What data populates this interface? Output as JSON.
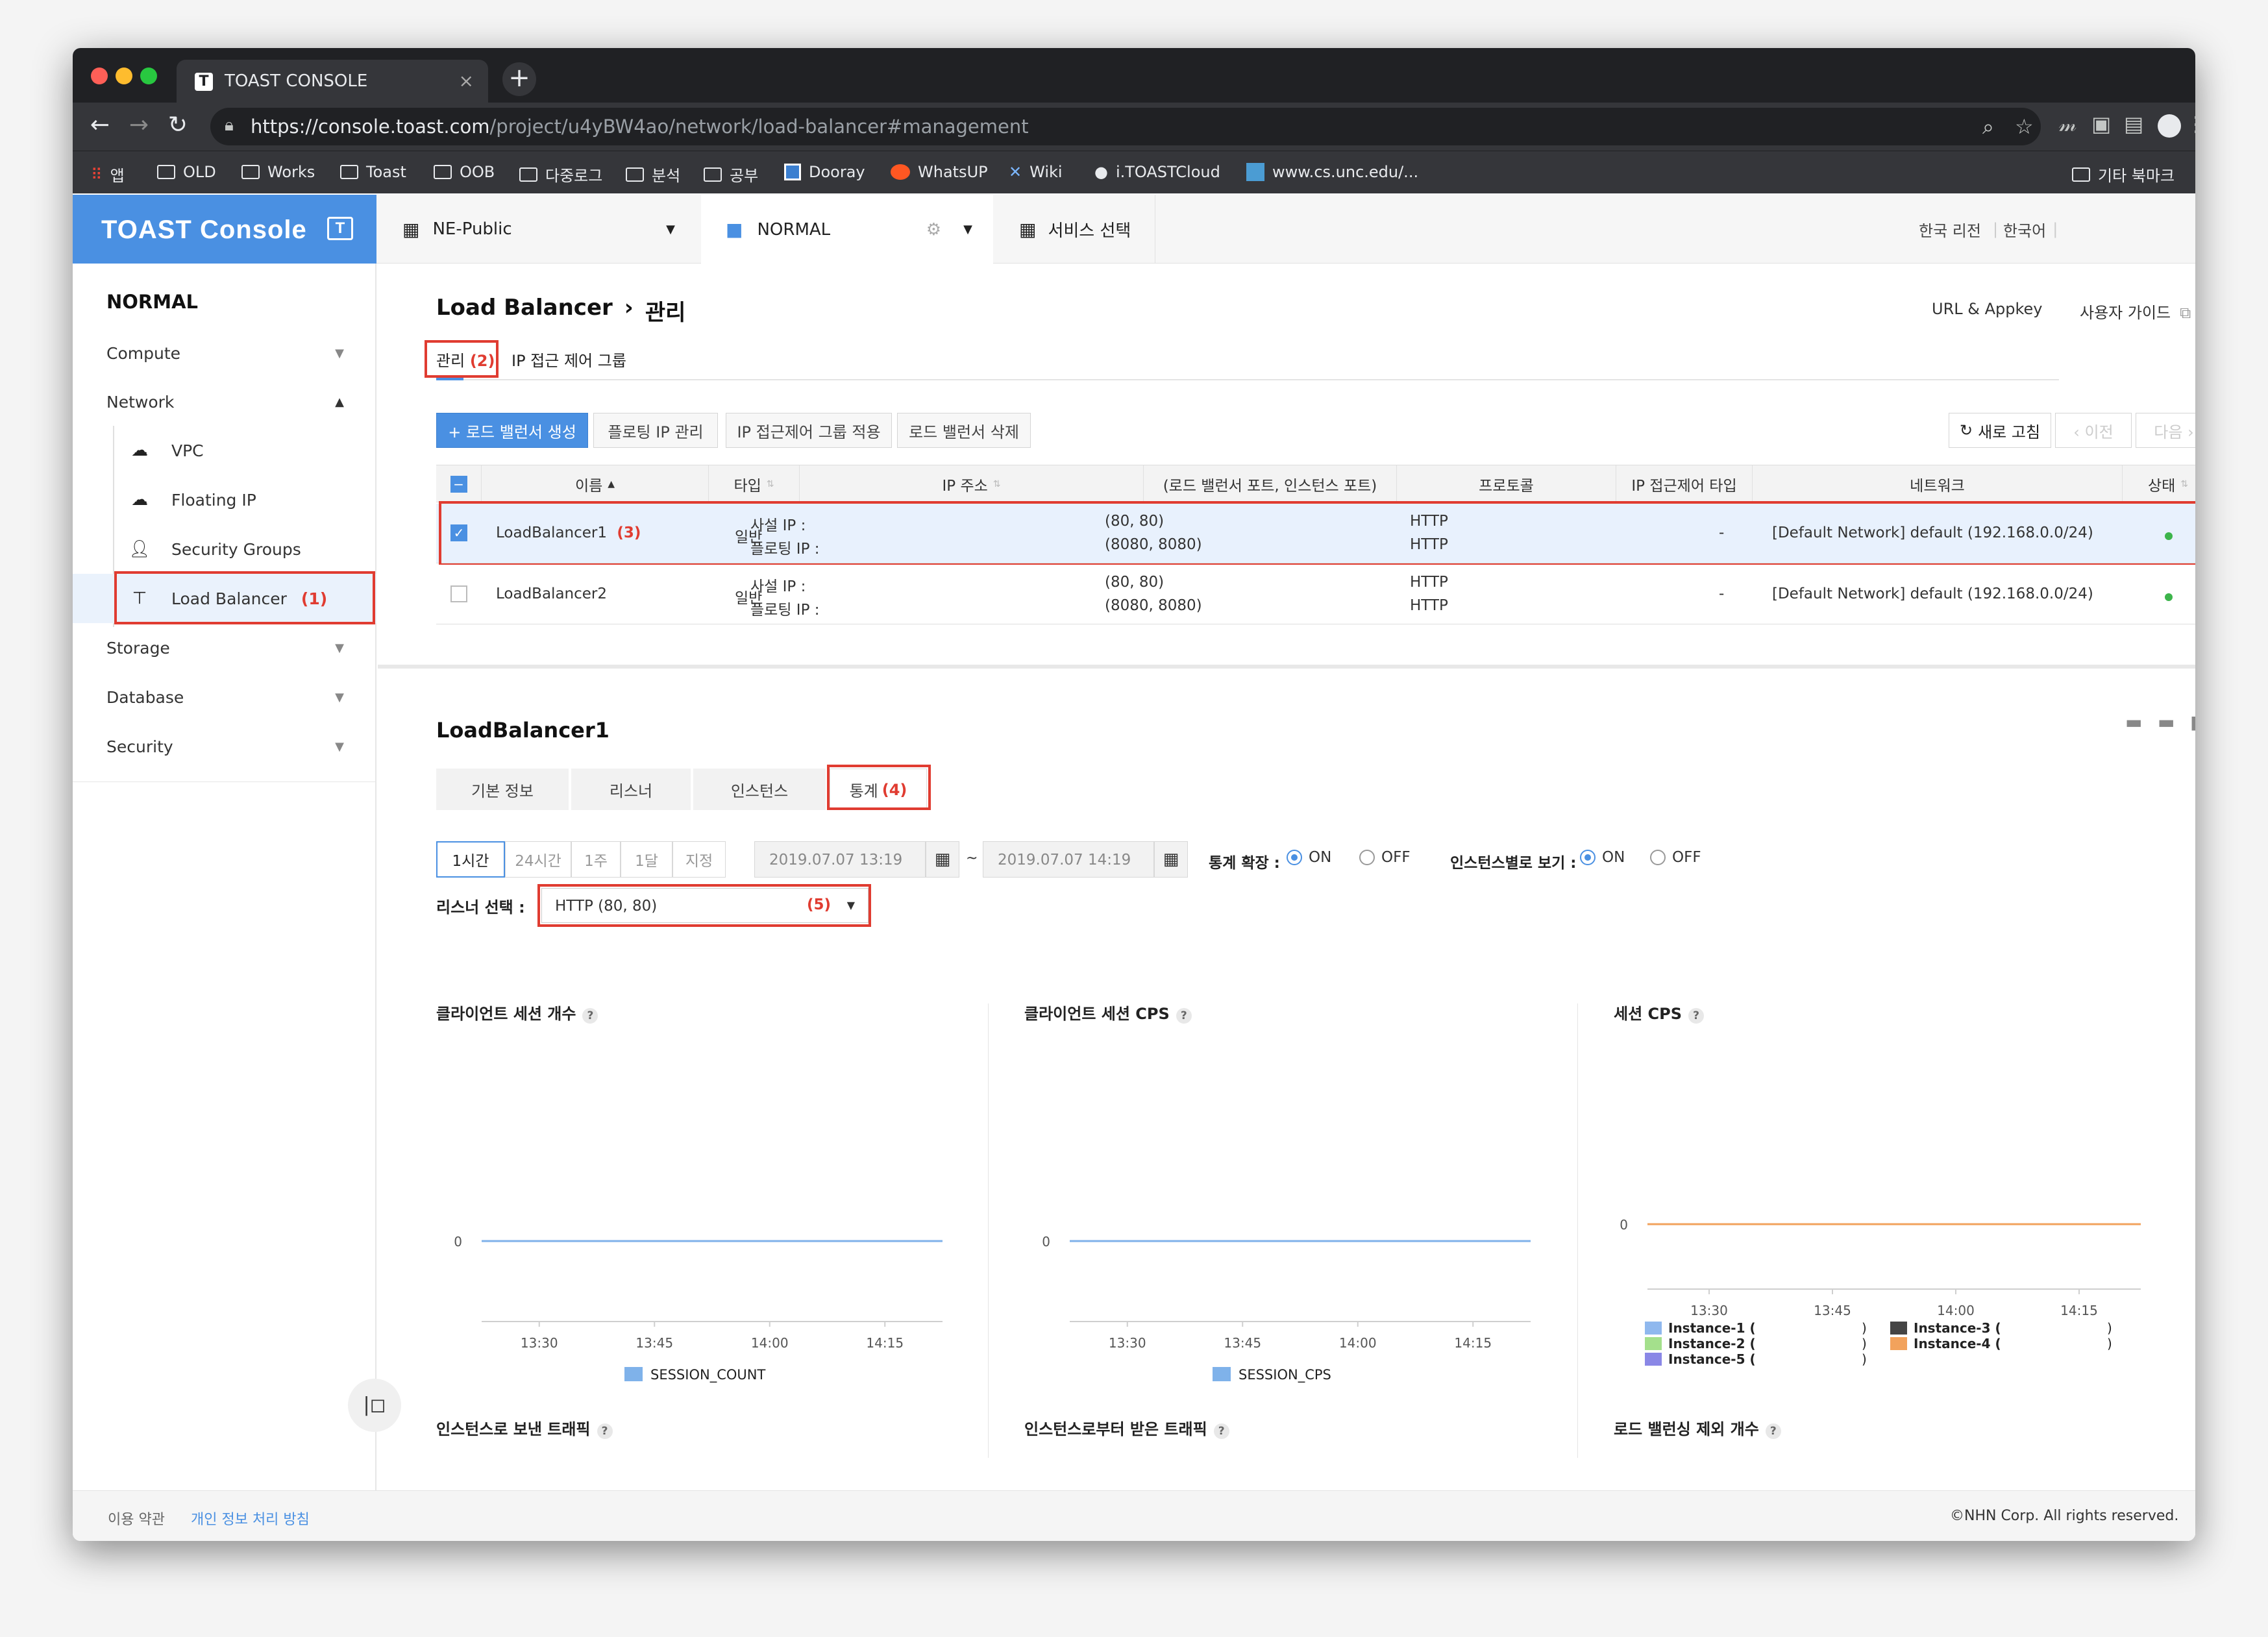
{
  "browser": {
    "tab_title": "TOAST CONSOLE",
    "url_host": "https://console.toast.com",
    "url_path": "/project/u4yBW4ao/network/load-balancer#management",
    "bookmarks": [
      "앱",
      "OLD",
      "Works",
      "Toast",
      "OOB",
      "다중로그",
      "분석",
      "공부",
      "Dooray",
      "WhatsUP",
      "Wiki",
      "i.TOASTCloud",
      "www.cs.unc.edu/...",
      "기타 북마크"
    ]
  },
  "header": {
    "logo": "TOAST Console",
    "org_select": "NE-Public",
    "project_select": "NORMAL",
    "service_select": "서비스 선택",
    "region": "한국 리전",
    "language": "한국어"
  },
  "sidebar": {
    "project": "NORMAL",
    "items": [
      {
        "label": "Compute"
      },
      {
        "label": "Network"
      },
      {
        "label": "VPC"
      },
      {
        "label": "Floating IP"
      },
      {
        "label": "Security Groups"
      },
      {
        "label": "Load Balancer",
        "marker": "(1)"
      },
      {
        "label": "Storage"
      },
      {
        "label": "Database"
      },
      {
        "label": "Security"
      }
    ]
  },
  "page": {
    "title": "Load Balancer",
    "title_sep": "›",
    "subtitle": "관리",
    "links": [
      "URL & Appkey",
      "사용자 가이드"
    ],
    "tabs": [
      {
        "label": "관리",
        "marker": "(2)"
      },
      {
        "label": "IP 접근 제어 그룹"
      }
    ]
  },
  "actions": {
    "create": "+ 로드 밸런서 생성",
    "floating": "플로팅 IP 관리",
    "acl_apply": "IP 접근제어 그룹 적용",
    "delete": "로드 밸런서 삭제",
    "refresh": "새로 고침",
    "prev": "‹ 이전",
    "next": "다음 ›"
  },
  "table": {
    "headers": [
      "이름",
      "타입",
      "IP 주소",
      "(로드 밸런서 포트, 인스턴스 포트)",
      "프로토콜",
      "IP 접근제어 타입",
      "네트워크",
      "상태"
    ],
    "rows": [
      {
        "name": "LoadBalancer1",
        "marker": "(3)",
        "type": "일반",
        "ip1": "사설 IP :",
        "ip2": "플로팅 IP :",
        "port1": "(80, 80)",
        "port2": "(8080, 8080)",
        "proto1": "HTTP",
        "proto2": "HTTP",
        "acl": "-",
        "network": "[Default Network] default (192.168.0.0/24)"
      },
      {
        "name": "LoadBalancer2",
        "marker": "",
        "type": "일반",
        "ip1": "사설 IP :",
        "ip2": "플로팅 IP :",
        "port1": "(80, 80)",
        "port2": "(8080, 8080)",
        "proto1": "HTTP",
        "proto2": "HTTP",
        "acl": "-",
        "network": "[Default Network] default (192.168.0.0/24)"
      }
    ]
  },
  "detail": {
    "title": "LoadBalancer1",
    "tabs": [
      "기본 정보",
      "리스너",
      "인스턴스",
      "통계"
    ],
    "stats_marker": "(4)",
    "ranges": [
      "1시간",
      "24시간",
      "1주",
      "1달",
      "지정"
    ],
    "date_from": "2019.07.07 13:19",
    "date_tilde": "~",
    "date_to": "2019.07.07 14:19",
    "stat_expand_label": "통계 확장 :",
    "per_instance_label": "인스턴스별로 보기 :",
    "on": "ON",
    "off": "OFF",
    "listener_label": "리스너 선택 :",
    "listener_value": "HTTP (80, 80)",
    "listener_marker": "(5)"
  },
  "chart_data": [
    {
      "type": "line",
      "title": "클라이언트 세션 개수",
      "x": [
        "13:30",
        "13:45",
        "14:00",
        "14:15"
      ],
      "series": [
        {
          "name": "SESSION_COUNT",
          "values": [
            0,
            0,
            0,
            0
          ]
        }
      ],
      "yticks": [
        "0"
      ],
      "color": "#7fb2ea"
    },
    {
      "type": "line",
      "title": "클라이언트 세션 CPS",
      "x": [
        "13:30",
        "13:45",
        "14:00",
        "14:15"
      ],
      "series": [
        {
          "name": "SESSION_CPS",
          "values": [
            0,
            0,
            0,
            0
          ]
        }
      ],
      "yticks": [
        "0"
      ],
      "color": "#7fb2ea"
    },
    {
      "type": "line",
      "title": "세션 CPS",
      "x": [
        "13:30",
        "13:45",
        "14:00",
        "14:15"
      ],
      "series": [
        {
          "name": "Instance-1 (",
          "suffix": ")",
          "values": [
            0,
            0,
            0,
            0
          ],
          "color": "#8fb8ee"
        },
        {
          "name": "Instance-2 (",
          "suffix": ")",
          "values": [
            0,
            0,
            0,
            0
          ],
          "color": "#a4e08c"
        },
        {
          "name": "Instance-5 (",
          "suffix": ")",
          "values": [
            0,
            0,
            0,
            0
          ],
          "color": "#8a87e6"
        },
        {
          "name": "Instance-3 (",
          "suffix": ")",
          "values": [
            0,
            0,
            0,
            0
          ],
          "color": "#444444"
        },
        {
          "name": "Instance-4 (",
          "suffix": ")",
          "values": [
            0,
            0,
            0,
            0
          ],
          "color": "#f2a25c"
        }
      ],
      "yticks": [
        "0"
      ]
    }
  ],
  "next_charts": [
    "인스턴스로 보낸 트래픽",
    "인스턴스로부터 받은 트래픽",
    "로드 밸런싱 제외 개수"
  ],
  "footer": {
    "terms": "이용 약관",
    "privacy": "개인 정보 처리 방침",
    "copyright": "©NHN Corp. All rights reserved."
  },
  "colors": {
    "accent": "#4a90e2",
    "marker_red": "#e03c31",
    "status_green": "#3cb44b"
  }
}
